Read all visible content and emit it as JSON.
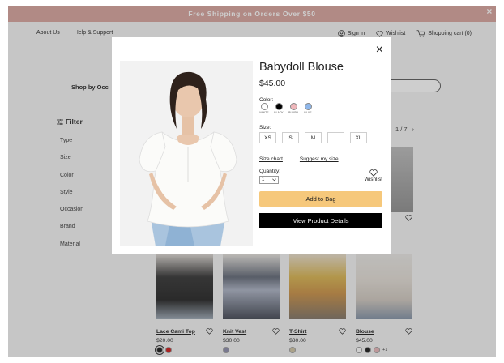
{
  "promo": {
    "text": "Free Shipping on Orders Over $50",
    "close": "×"
  },
  "nav": {
    "left": [
      "About Us",
      "Help & Support"
    ],
    "sign_in": "Sign in",
    "wishlist": "Wishlist",
    "cart": "Shopping cart (0)"
  },
  "page": {
    "shop_by": "Shop by Occ",
    "filter_title": "Filter",
    "filters": [
      "Type",
      "Size",
      "Color",
      "Style",
      "Occasion",
      "Brand",
      "Material"
    ],
    "pager": "1 / 7",
    "next": "›"
  },
  "products": [
    {
      "name": "Lace Cami Top",
      "price": "$20.00",
      "swatches": [
        "#111111",
        "#cc1111"
      ],
      "more": ""
    },
    {
      "name": "Knit Vest",
      "price": "$30.00",
      "swatches": [
        "#8a8aa8"
      ],
      "more": ""
    },
    {
      "name": "T-Shirt",
      "price": "$30.00",
      "swatches": [
        "#cfc3a0"
      ],
      "more": ""
    },
    {
      "name": "Blouse",
      "price": "$45.00",
      "swatches": [
        "#ffffff",
        "#111111",
        "#e8b4b8"
      ],
      "more": "+1"
    }
  ],
  "modal": {
    "close": "×",
    "title": "Babydoll Blouse",
    "price": "$45.00",
    "color_label": "Color:",
    "colors": [
      {
        "name": "WHITE",
        "hex": "#ffffff"
      },
      {
        "name": "BLACK",
        "hex": "#000000"
      },
      {
        "name": "BLUSH",
        "hex": "#efb7bb"
      },
      {
        "name": "BLUE",
        "hex": "#8fb7ea"
      }
    ],
    "size_label": "Size:",
    "sizes": [
      "XS",
      "S",
      "M",
      "L",
      "XL"
    ],
    "size_chart": "Size chart",
    "suggest_size": "Suggest my size",
    "quantity_label": "Quantity:",
    "quantity_value": "1",
    "wishlist": "Wishlist",
    "add_to_bag": "Add to Bag",
    "view_details": "View Product Details"
  },
  "colors": {
    "promo": "#d7a19a",
    "add_to_bag": "#f6c87b",
    "primary_button": "#000000"
  }
}
